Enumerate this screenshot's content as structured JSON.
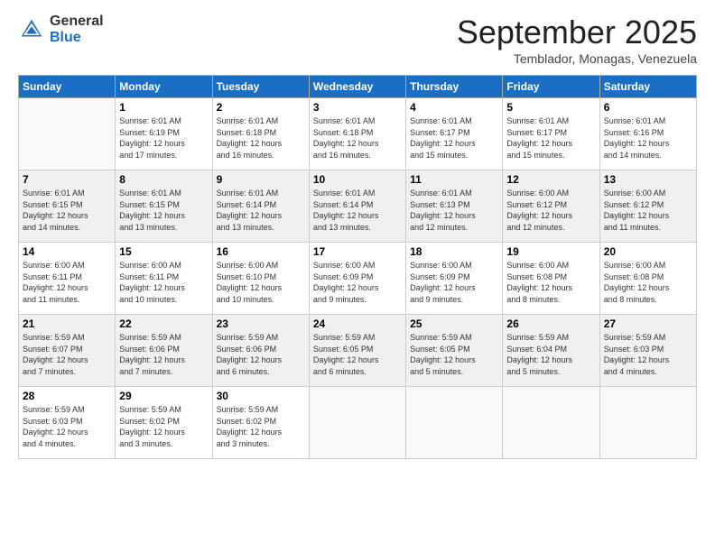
{
  "logo": {
    "general": "General",
    "blue": "Blue"
  },
  "header": {
    "month": "September 2025",
    "location": "Temblador, Monagas, Venezuela"
  },
  "weekdays": [
    "Sunday",
    "Monday",
    "Tuesday",
    "Wednesday",
    "Thursday",
    "Friday",
    "Saturday"
  ],
  "weeks": [
    [
      {
        "day": "",
        "info": ""
      },
      {
        "day": "1",
        "info": "Sunrise: 6:01 AM\nSunset: 6:19 PM\nDaylight: 12 hours\nand 17 minutes."
      },
      {
        "day": "2",
        "info": "Sunrise: 6:01 AM\nSunset: 6:18 PM\nDaylight: 12 hours\nand 16 minutes."
      },
      {
        "day": "3",
        "info": "Sunrise: 6:01 AM\nSunset: 6:18 PM\nDaylight: 12 hours\nand 16 minutes."
      },
      {
        "day": "4",
        "info": "Sunrise: 6:01 AM\nSunset: 6:17 PM\nDaylight: 12 hours\nand 15 minutes."
      },
      {
        "day": "5",
        "info": "Sunrise: 6:01 AM\nSunset: 6:17 PM\nDaylight: 12 hours\nand 15 minutes."
      },
      {
        "day": "6",
        "info": "Sunrise: 6:01 AM\nSunset: 6:16 PM\nDaylight: 12 hours\nand 14 minutes."
      }
    ],
    [
      {
        "day": "7",
        "info": "Sunrise: 6:01 AM\nSunset: 6:15 PM\nDaylight: 12 hours\nand 14 minutes."
      },
      {
        "day": "8",
        "info": "Sunrise: 6:01 AM\nSunset: 6:15 PM\nDaylight: 12 hours\nand 13 minutes."
      },
      {
        "day": "9",
        "info": "Sunrise: 6:01 AM\nSunset: 6:14 PM\nDaylight: 12 hours\nand 13 minutes."
      },
      {
        "day": "10",
        "info": "Sunrise: 6:01 AM\nSunset: 6:14 PM\nDaylight: 12 hours\nand 13 minutes."
      },
      {
        "day": "11",
        "info": "Sunrise: 6:01 AM\nSunset: 6:13 PM\nDaylight: 12 hours\nand 12 minutes."
      },
      {
        "day": "12",
        "info": "Sunrise: 6:00 AM\nSunset: 6:12 PM\nDaylight: 12 hours\nand 12 minutes."
      },
      {
        "day": "13",
        "info": "Sunrise: 6:00 AM\nSunset: 6:12 PM\nDaylight: 12 hours\nand 11 minutes."
      }
    ],
    [
      {
        "day": "14",
        "info": "Sunrise: 6:00 AM\nSunset: 6:11 PM\nDaylight: 12 hours\nand 11 minutes."
      },
      {
        "day": "15",
        "info": "Sunrise: 6:00 AM\nSunset: 6:11 PM\nDaylight: 12 hours\nand 10 minutes."
      },
      {
        "day": "16",
        "info": "Sunrise: 6:00 AM\nSunset: 6:10 PM\nDaylight: 12 hours\nand 10 minutes."
      },
      {
        "day": "17",
        "info": "Sunrise: 6:00 AM\nSunset: 6:09 PM\nDaylight: 12 hours\nand 9 minutes."
      },
      {
        "day": "18",
        "info": "Sunrise: 6:00 AM\nSunset: 6:09 PM\nDaylight: 12 hours\nand 9 minutes."
      },
      {
        "day": "19",
        "info": "Sunrise: 6:00 AM\nSunset: 6:08 PM\nDaylight: 12 hours\nand 8 minutes."
      },
      {
        "day": "20",
        "info": "Sunrise: 6:00 AM\nSunset: 6:08 PM\nDaylight: 12 hours\nand 8 minutes."
      }
    ],
    [
      {
        "day": "21",
        "info": "Sunrise: 5:59 AM\nSunset: 6:07 PM\nDaylight: 12 hours\nand 7 minutes."
      },
      {
        "day": "22",
        "info": "Sunrise: 5:59 AM\nSunset: 6:06 PM\nDaylight: 12 hours\nand 7 minutes."
      },
      {
        "day": "23",
        "info": "Sunrise: 5:59 AM\nSunset: 6:06 PM\nDaylight: 12 hours\nand 6 minutes."
      },
      {
        "day": "24",
        "info": "Sunrise: 5:59 AM\nSunset: 6:05 PM\nDaylight: 12 hours\nand 6 minutes."
      },
      {
        "day": "25",
        "info": "Sunrise: 5:59 AM\nSunset: 6:05 PM\nDaylight: 12 hours\nand 5 minutes."
      },
      {
        "day": "26",
        "info": "Sunrise: 5:59 AM\nSunset: 6:04 PM\nDaylight: 12 hours\nand 5 minutes."
      },
      {
        "day": "27",
        "info": "Sunrise: 5:59 AM\nSunset: 6:03 PM\nDaylight: 12 hours\nand 4 minutes."
      }
    ],
    [
      {
        "day": "28",
        "info": "Sunrise: 5:59 AM\nSunset: 6:03 PM\nDaylight: 12 hours\nand 4 minutes."
      },
      {
        "day": "29",
        "info": "Sunrise: 5:59 AM\nSunset: 6:02 PM\nDaylight: 12 hours\nand 3 minutes."
      },
      {
        "day": "30",
        "info": "Sunrise: 5:59 AM\nSunset: 6:02 PM\nDaylight: 12 hours\nand 3 minutes."
      },
      {
        "day": "",
        "info": ""
      },
      {
        "day": "",
        "info": ""
      },
      {
        "day": "",
        "info": ""
      },
      {
        "day": "",
        "info": ""
      }
    ]
  ]
}
